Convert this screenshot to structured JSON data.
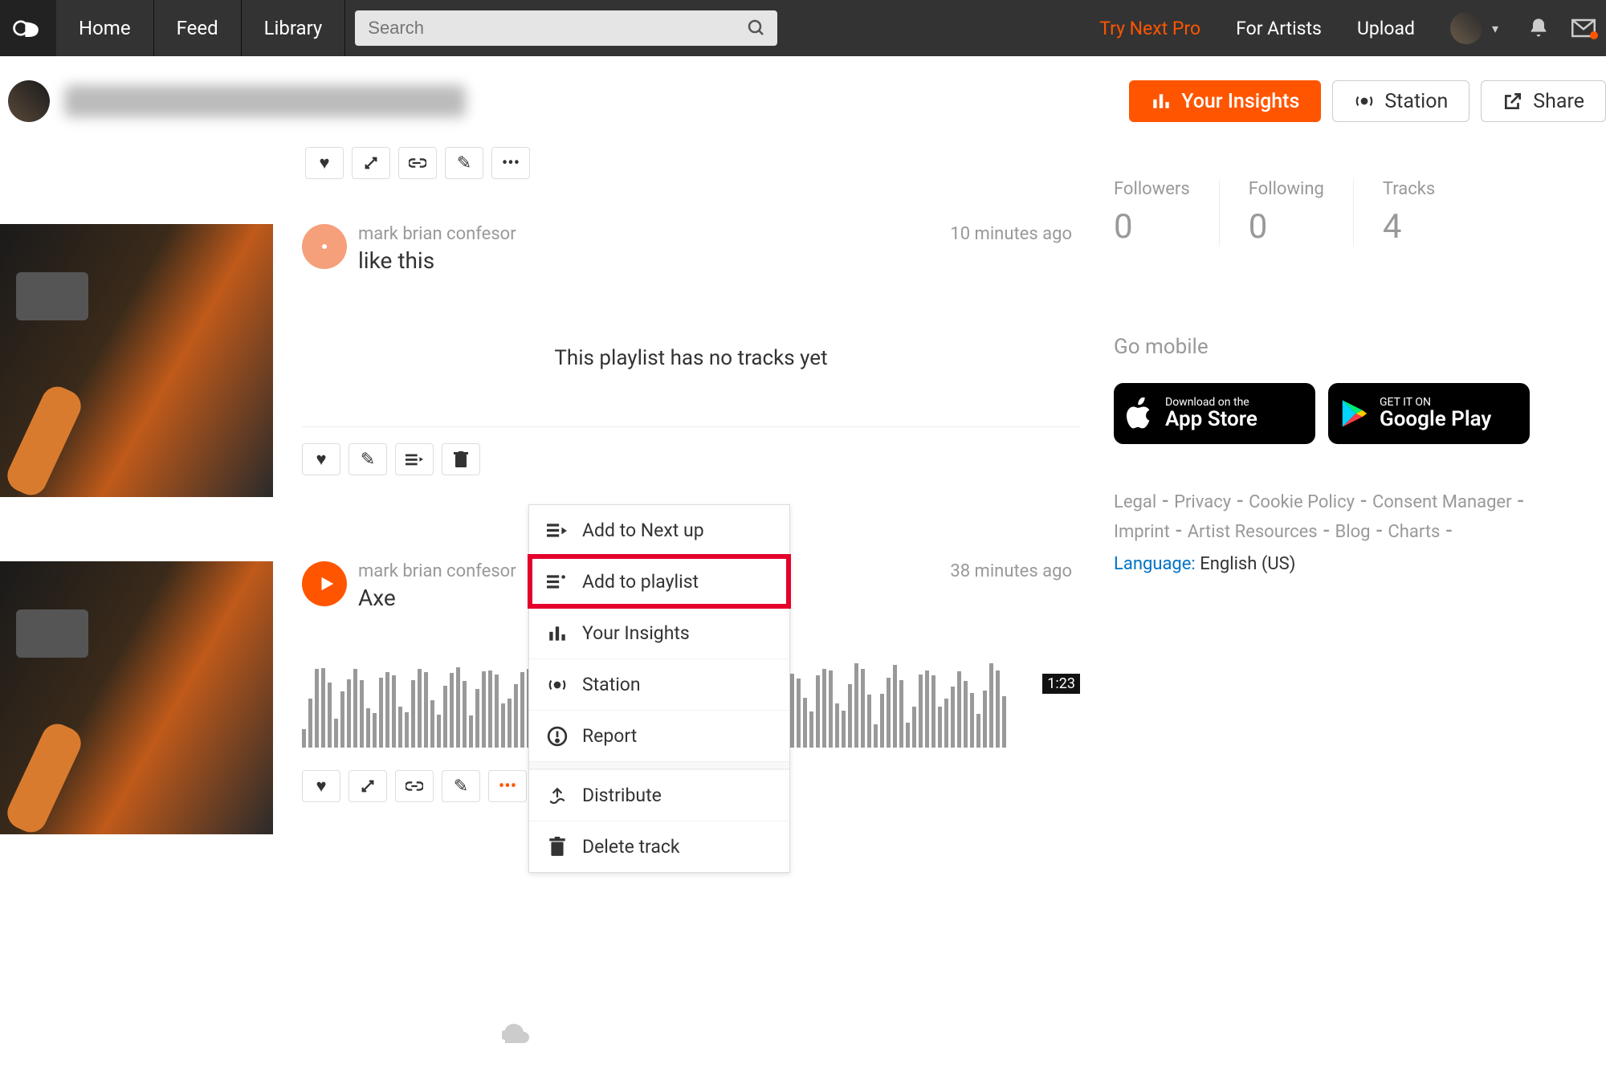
{
  "header": {
    "nav": {
      "home": "Home",
      "feed": "Feed",
      "library": "Library"
    },
    "search_placeholder": "Search",
    "try_pro": "Try Next Pro",
    "for_artists": "For Artists",
    "upload": "Upload"
  },
  "subheader": {
    "insights": "Your Insights",
    "station": "Station",
    "share": "Share"
  },
  "tracks": [
    {
      "artist": "mark brian confesor",
      "title": "like this",
      "time": "10 minutes ago",
      "empty_msg": "This playlist has no tracks yet"
    },
    {
      "artist": "mark brian confesor",
      "title": "Axe",
      "time": "38 minutes ago",
      "duration": "1:23"
    }
  ],
  "menu": {
    "next_up": "Add to Next up",
    "playlist": "Add to playlist",
    "insights": "Your Insights",
    "station": "Station",
    "report": "Report",
    "distribute": "Distribute",
    "delete": "Delete track"
  },
  "sidebar": {
    "stats": [
      {
        "label": "Followers",
        "value": "0"
      },
      {
        "label": "Following",
        "value": "0"
      },
      {
        "label": "Tracks",
        "value": "4"
      }
    ],
    "go_mobile": "Go mobile",
    "appstore_small": "Download on the",
    "appstore_big": "App Store",
    "gplay_small": "GET IT ON",
    "gplay_big": "Google Play",
    "legal": "Legal ⁃ Privacy ⁃ Cookie Policy ⁃ Consent Manager ⁃ Imprint ⁃ Artist Resources ⁃ Blog ⁃ Charts ⁃",
    "lang_key": "Language:",
    "lang_val": " English (US)"
  }
}
